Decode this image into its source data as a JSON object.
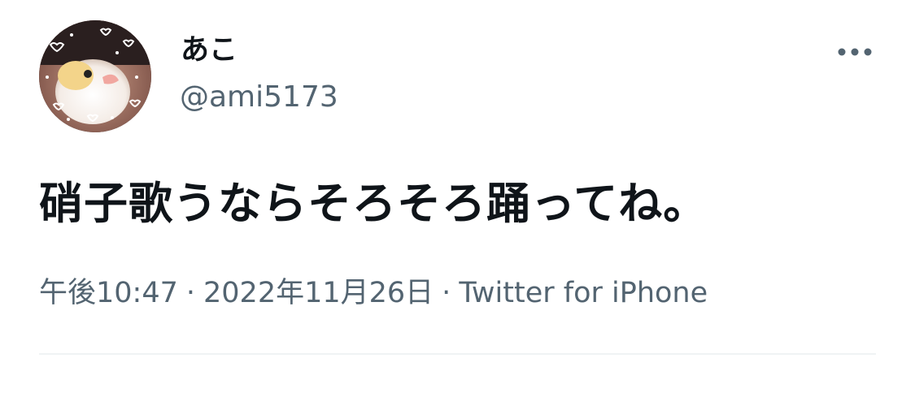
{
  "author": {
    "display_name": "あこ",
    "handle": "@ami5173",
    "avatar_icon": "avatar-bird-photo"
  },
  "tweet": {
    "text": "硝子歌うならそろそろ踊ってね。"
  },
  "meta": {
    "time": "午後10:47",
    "separator1": "·",
    "date": "2022年11月26日",
    "separator2": "·",
    "source": "Twitter for iPhone"
  },
  "actions": {
    "more_icon": "more-horizontal-icon"
  },
  "colors": {
    "text_primary": "#0f1419",
    "text_secondary": "#536471",
    "divider": "#eff3f4"
  }
}
